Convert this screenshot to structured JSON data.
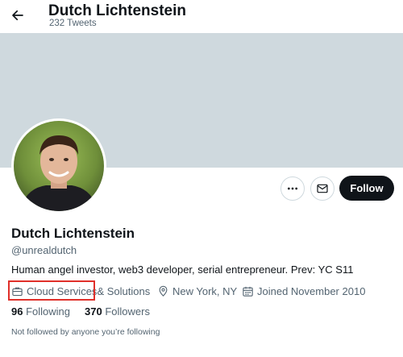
{
  "header": {
    "title": "Dutch Lichtenstein",
    "tweet_count": "232 Tweets"
  },
  "profile": {
    "name": "Dutch Lichtenstein",
    "handle": "@unrealdutch",
    "bio": "Human angel investor, web3 developer, serial entrepreneur. Prev: YC S11",
    "category_part1": "Cloud Services",
    "category_part2": "& Solutions",
    "location": "New York, NY",
    "joined": "Joined November 2010",
    "following_count": "96",
    "following_label": "Following",
    "followers_count": "370",
    "followers_label": "Followers",
    "followed_by_note": "Not followed by anyone you’re following"
  },
  "actions": {
    "follow_label": "Follow"
  },
  "colors": {
    "banner": "#cfd9de",
    "follow_button": "#0f1419",
    "highlight_box": "#e0302a"
  }
}
